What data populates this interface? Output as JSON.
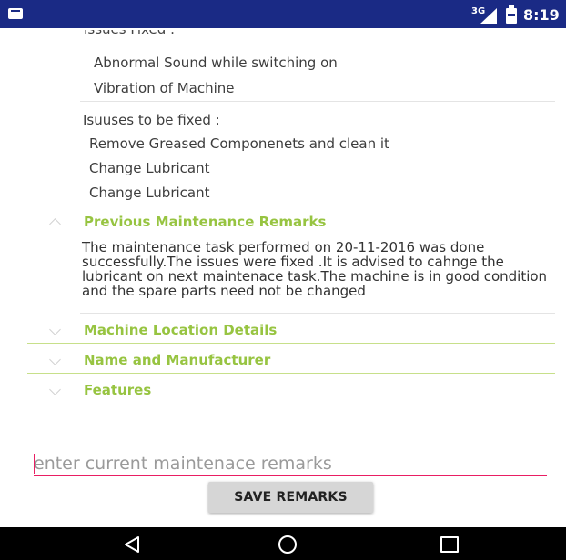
{
  "status_bar": {
    "network": "3G",
    "time": "8:19",
    "icons": [
      "notification-icon",
      "signal-icon",
      "battery-icon"
    ]
  },
  "issues_fixed": {
    "partial_header": "Issues Fixed :",
    "items": [
      "Abnormal Sound while switching on",
      "Vibration of Machine"
    ]
  },
  "issues_to_fix": {
    "header": "Isuuses to be fixed :",
    "items": [
      "Remove Greased Componenets and clean it",
      "Change Lubricant",
      "Change Lubricant"
    ]
  },
  "sections": {
    "previous_remarks": {
      "title": "Previous Maintenance Remarks",
      "expanded": true,
      "text": "The maintenance task performed on 20-11-2016 was done successfully.The issues were fixed .It is advised to cahnge the lubricant on next maintenace task.The machine is in good condition and the spare parts need not be changed"
    },
    "machine_location": {
      "title": "Machine Location Details",
      "expanded": false
    },
    "name_manufacturer": {
      "title": "Name and Manufacturer",
      "expanded": false
    },
    "features": {
      "title": "Features",
      "expanded": false
    }
  },
  "remarks_input": {
    "value": "",
    "placeholder": "enter current maintenace remarks"
  },
  "save_button": {
    "label": "SAVE REMARKS"
  },
  "colors": {
    "status_bar": "#1a2a85",
    "section_title": "#97c441",
    "input_accent": "#e91e63",
    "nav_bar": "#000000"
  },
  "nav_bar": {
    "icons": [
      "back-icon",
      "home-icon",
      "recents-icon"
    ]
  }
}
